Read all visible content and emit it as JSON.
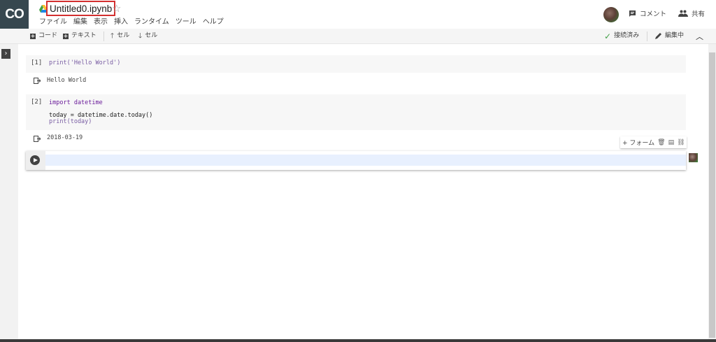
{
  "app": {
    "logo_text": "CO",
    "notebook_title": "Untitled0.ipynb",
    "menu": [
      "ファイル",
      "編集",
      "表示",
      "挿入",
      "ランタイム",
      "ツール",
      "ヘルプ"
    ]
  },
  "header_actions": {
    "comment_label": "コメント",
    "share_label": "共有"
  },
  "toolbar": {
    "add_code_label": "コード",
    "add_text_label": "テキスト",
    "cell_up_label": "セル",
    "cell_down_label": "セル",
    "connection_status": "接続済み",
    "edit_status": "編集中"
  },
  "cells": [
    {
      "exec_count": "[1]",
      "code_lines": [
        "print('Hello World')"
      ],
      "output": "Hello World"
    },
    {
      "exec_count": "[2]",
      "code_lines": [
        "import datetime",
        "",
        "today = datetime.date.today()",
        "print(today)"
      ],
      "output": "2018-03-19"
    }
  ],
  "cell_toolbar": {
    "form_label": "+ フォーム"
  },
  "colors": {
    "title_highlight": "#d32f2f",
    "logo_bg": "#37474f",
    "connected": "#43a047"
  }
}
